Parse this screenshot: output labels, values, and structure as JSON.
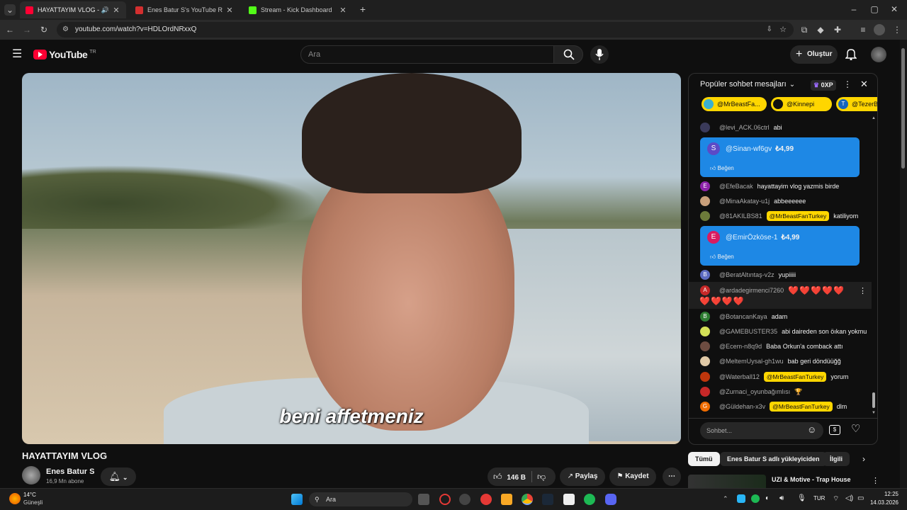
{
  "browser": {
    "tabs": [
      {
        "title": "HAYATTAYIM VLOG - YouTube"
      },
      {
        "title": "Enes Batur S's YouTube Realtime"
      },
      {
        "title": "Stream - Kick Dashboard"
      }
    ],
    "url": "youtube.com/watch?v=HDLOrdNRxxQ"
  },
  "header": {
    "logo": "YouTube",
    "region": "TR",
    "search_placeholder": "Ara",
    "create_label": "Oluştur"
  },
  "video": {
    "subtitle": "beni affetmeniz",
    "title": "HAYATTAYIM VLOG"
  },
  "channel": {
    "name": "Enes Batur S",
    "subscribers": "16,9 Mn abone"
  },
  "actions": {
    "likes": "146 B",
    "share": "Paylaş",
    "save": "Kaydet"
  },
  "chat": {
    "title": "Popüler sohbet mesajları",
    "xp": "0XP",
    "chips": [
      "@MrBeastFa...",
      "@Kinnepi",
      "@TezerB"
    ],
    "input_placeholder": "Sohbet...",
    "messages": [
      {
        "author": "@levi_ACK.06ctrl",
        "text": "abi"
      },
      {
        "author": "@EfeBacak",
        "text": "hayattayim vlog yazmis birde"
      },
      {
        "author": "@MinaAkatay-u1j",
        "text": "abbeeeeee"
      },
      {
        "author": "@81AKILBS81",
        "mention": "@MrBeastFanTurkey",
        "text": "katiliyom"
      },
      {
        "author": "@BeratAltıntaş-v2z",
        "text": "yupiiiii"
      },
      {
        "author": "@ardadegirmenci7260",
        "text": "❤️❤️❤️❤️❤️",
        "text2": "❤️❤️❤️❤️"
      },
      {
        "author": "@BotancanKaya",
        "text": "adam"
      },
      {
        "author": "@GAMEBUSTER35",
        "text": "abi daireden son öıkan yokmu"
      },
      {
        "author": "@Ecem-n8q9d",
        "text": "Baba Orkun'a comback attı"
      },
      {
        "author": "@MeltemUysal-gh1wu",
        "text": "bab geri döndüüğğ"
      },
      {
        "author": "@Waterball12",
        "mention": "@MrBeastFanTurkey",
        "text": "yorum"
      },
      {
        "author": "@Zurnaci_oyunbağımlısı",
        "text": "🏆"
      },
      {
        "author": "@Güldehan-x3v",
        "mention": "@MrBeastFanTurkey",
        "text": "dlm"
      }
    ],
    "superchats": [
      {
        "author": "@Sinan-wf6gv",
        "amount": "₺4,99",
        "like": "Beğen",
        "initial": "S"
      },
      {
        "author": "@EmirÖzköse-1",
        "amount": "₺4,99",
        "like": "Beğen",
        "initial": "E"
      }
    ]
  },
  "related": {
    "tabs": [
      "Tümü",
      "Enes Batur S adlı yükleyiciden",
      "İlgili"
    ],
    "first_title": "UZI & Motive - Trap House"
  },
  "taskbar": {
    "weather_temp": "14°C",
    "weather_desc": "Güneşli",
    "search": "Ara",
    "lang": "TUR",
    "time": "12:25",
    "date": "14.03.2026"
  },
  "colors": {
    "accent_red": "#ff0033",
    "superchat_blue": "#1e88e5",
    "mention_yellow": "#ffd600"
  }
}
